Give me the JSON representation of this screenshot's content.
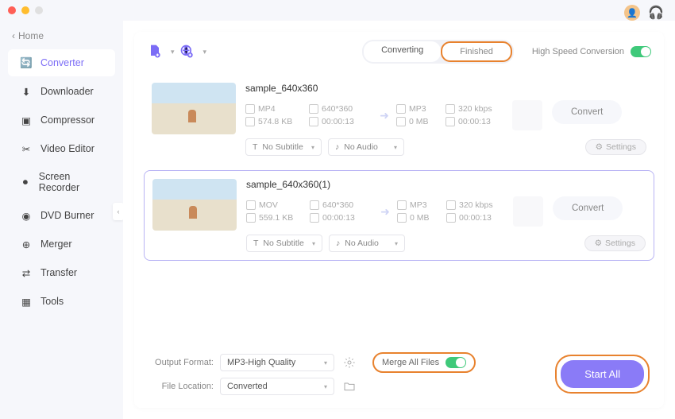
{
  "home_label": "Home",
  "nav": [
    {
      "label": "Converter",
      "icon": "converter"
    },
    {
      "label": "Downloader",
      "icon": "downloader"
    },
    {
      "label": "Compressor",
      "icon": "compressor"
    },
    {
      "label": "Video Editor",
      "icon": "editor"
    },
    {
      "label": "Screen Recorder",
      "icon": "recorder"
    },
    {
      "label": "DVD Burner",
      "icon": "burner"
    },
    {
      "label": "Merger",
      "icon": "merger"
    },
    {
      "label": "Transfer",
      "icon": "transfer"
    },
    {
      "label": "Tools",
      "icon": "tools"
    }
  ],
  "tabs": {
    "converting": "Converting",
    "finished": "Finished"
  },
  "high_speed": "High Speed Conversion",
  "items": [
    {
      "title": "sample_640x360",
      "src": {
        "format": "MP4",
        "res": "640*360",
        "size": "574.8 KB",
        "dur": "00:00:13"
      },
      "out": {
        "format": "MP3",
        "bitrate": "320 kbps",
        "size": "0 MB",
        "dur": "00:00:13"
      },
      "subtitle": "No Subtitle",
      "audio": "No Audio",
      "settings": "Settings",
      "convert": "Convert"
    },
    {
      "title": "sample_640x360(1)",
      "src": {
        "format": "MOV",
        "res": "640*360",
        "size": "559.1 KB",
        "dur": "00:00:13"
      },
      "out": {
        "format": "MP3",
        "bitrate": "320 kbps",
        "size": "0 MB",
        "dur": "00:00:13"
      },
      "subtitle": "No Subtitle",
      "audio": "No Audio",
      "settings": "Settings",
      "convert": "Convert"
    }
  ],
  "footer": {
    "output_format_label": "Output Format:",
    "output_format_value": "MP3-High Quality",
    "file_location_label": "File Location:",
    "file_location_value": "Converted",
    "merge_label": "Merge All Files",
    "start_all": "Start All"
  }
}
